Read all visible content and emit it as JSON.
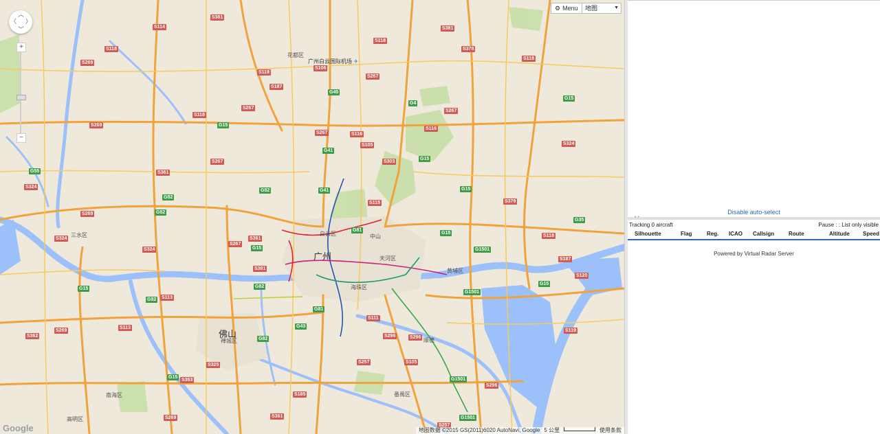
{
  "map": {
    "menu_label": "Menu",
    "map_type": "地图",
    "zoom_in": "+",
    "zoom_out": "−",
    "zoom_level": 0.45,
    "google_logo": "Google",
    "attribution_data": "地图数据 ©2015 GS(2011)6020 AutoNavi, Google",
    "scale_label": "5 公里",
    "terms": "使用条款",
    "airport_name": "广州白云国际机场",
    "cities": {
      "guangzhou": "广州",
      "foshan": "佛山",
      "baiyun": "白云区",
      "tianhe": "天河区",
      "haizhu": "海珠区",
      "panyu": "番禺区",
      "huadu": "花都区",
      "huangpu": "黄埔区",
      "nanhai": "南海区",
      "chancheng": "禅城区",
      "sanshui": "三水区",
      "zhongshan": "中山",
      "shunde": "顺德",
      "gaoming": "高明区"
    },
    "road_labels_s": [
      "S381",
      "S114",
      "S118",
      "S269",
      "S118",
      "S381",
      "S106",
      "S267",
      "S116",
      "S118",
      "S378",
      "S267",
      "S118",
      "S118",
      "S269",
      "S187",
      "S267",
      "S116",
      "S105",
      "S303",
      "S115",
      "S267",
      "S324",
      "S361",
      "S381",
      "S267",
      "S324",
      "S379",
      "S324",
      "S269",
      "S324",
      "S267",
      "S361",
      "S187",
      "S120",
      "S111",
      "S296",
      "S296",
      "S257",
      "S105",
      "S362",
      "S269",
      "S113",
      "S113",
      "S118",
      "S296",
      "S119",
      "S325",
      "S363",
      "S185",
      "S257",
      "S361",
      "S269"
    ],
    "road_labels_g": [
      "G45",
      "G4",
      "G15",
      "G41",
      "G41",
      "G15",
      "G55",
      "G82",
      "G82",
      "G82",
      "G15",
      "G81",
      "G15",
      "G35",
      "G82",
      "G15",
      "G1501",
      "G15",
      "G15",
      "G1501",
      "G43",
      "G81",
      "G82",
      "G15",
      "G1501",
      "G1501",
      "G82",
      "G15"
    ]
  },
  "panel": {
    "disable_auto_select": "Disable auto-select",
    "tracking": "Tracking 0 aircraft",
    "pause": "Pause",
    "list_only_visible": "List only visible",
    "columns": [
      "Silhouette",
      "Flag",
      "Reg.",
      "ICAO",
      "Callsign",
      "Route",
      "Altitude",
      "Speed"
    ],
    "powered_by": "Powered by Virtual Radar Server"
  },
  "colors": {
    "link": "#2a6ab3",
    "land": "#efe9dc",
    "water": "#9cc0f9",
    "highway": "#f2a23a",
    "park": "#c8dfa8"
  }
}
